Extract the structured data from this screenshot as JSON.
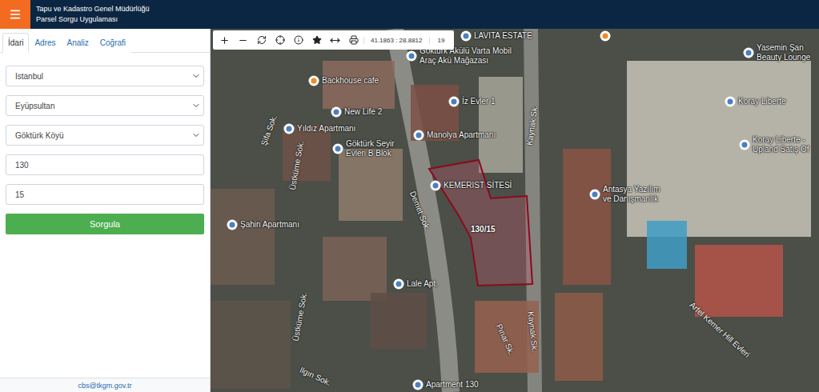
{
  "header": {
    "title_lines": [
      "Tapu ve Kadastro Genel Müdürlüğü",
      "Parsel Sorgu Uygulaması"
    ]
  },
  "tabs": [
    {
      "label": "İdari",
      "selected": true
    },
    {
      "label": "Adres",
      "selected": false
    },
    {
      "label": "Analiz",
      "selected": false
    },
    {
      "label": "Coğrafi",
      "selected": false
    }
  ],
  "form": {
    "fields": [
      {
        "kind": "select",
        "value": "İstanbul"
      },
      {
        "kind": "select",
        "value": "Eyüpsultan"
      },
      {
        "kind": "select",
        "value": "Göktürk Köyü"
      },
      {
        "kind": "input",
        "value": "130"
      },
      {
        "kind": "input",
        "value": "15"
      }
    ],
    "submit": "Sorgula"
  },
  "footer": "cbs@tkgm.gov.tr",
  "map": {
    "toolbar": {
      "coordinates": "41.1863 : 28.8812",
      "zoom": "19"
    },
    "parcel": {
      "label": "130/15"
    },
    "places": [
      {
        "kind": "pin",
        "lines": [
          "LAVITA ESTATE"
        ],
        "color": "#4a7fc1"
      },
      {
        "kind": "pin",
        "lines": [
          "Göktürk Akülü Varta Mobil",
          "Araç Akü Mağazası"
        ],
        "color": "#4a7fc1"
      },
      {
        "kind": "pin",
        "lines": [
          "Backhouse cafe"
        ],
        "color": "#f08a24"
      },
      {
        "kind": "pin",
        "lines": [],
        "color": "#f08a24"
      },
      {
        "kind": "pin",
        "lines": [
          "New Life 2"
        ],
        "color": "#4a7fc1"
      },
      {
        "kind": "pin",
        "lines": [
          "Yıldız Apartmanı"
        ],
        "color": "#4a7fc1"
      },
      {
        "kind": "pin",
        "lines": [
          "Göktürk Seyir",
          "Evleri B Blok"
        ],
        "color": "#4a7fc1"
      },
      {
        "kind": "pin",
        "lines": [
          "İz Evler 1"
        ],
        "color": "#4a7fc1"
      },
      {
        "kind": "pin",
        "lines": [
          "Manolya Apartmanı"
        ],
        "color": "#4a7fc1"
      },
      {
        "kind": "pin",
        "lines": [
          "KEMERIST SİTESİ"
        ],
        "color": "#4a7fc1"
      },
      {
        "kind": "pin",
        "lines": [
          "Şahin Apartmanı"
        ],
        "color": "#4a7fc1"
      },
      {
        "kind": "pin",
        "lines": [
          "Lale Apt."
        ],
        "color": "#4a7fc1"
      },
      {
        "kind": "pin",
        "lines": [
          "Antasya Yazılım",
          "ve Danışmanlık"
        ],
        "color": "#4a7fc1"
      },
      {
        "kind": "pin",
        "lines": [
          "Koray Liberte"
        ],
        "color": "#4a7fc1"
      },
      {
        "kind": "pin",
        "lines": [
          "Koray Liberte -",
          "Upland Satış Of"
        ],
        "color": "#4a7fc1"
      },
      {
        "kind": "pin",
        "lines": [
          "Yasemin Şan",
          "Beauty Lounge"
        ],
        "color": "#4a7fc1"
      },
      {
        "kind": "pin",
        "lines": [
          "Apartment 130"
        ],
        "color": "#4a7fc1"
      },
      {
        "kind": "street",
        "lines": [
          "Şifa Sok."
        ],
        "color": "#ffffff"
      },
      {
        "kind": "street",
        "lines": [
          "Üstküme Sok."
        ],
        "color": "#ffffff"
      },
      {
        "kind": "street",
        "lines": [
          "Üstküme Sok."
        ],
        "color": "#ffffff"
      },
      {
        "kind": "street",
        "lines": [
          "Demet Sok."
        ],
        "color": "#ffffff"
      },
      {
        "kind": "street",
        "lines": [
          "Kaynak Sk."
        ],
        "color": "#ffffff"
      },
      {
        "kind": "street",
        "lines": [
          "Kaynak Sk."
        ],
        "color": "#ffffff"
      },
      {
        "kind": "street",
        "lines": [
          "Pınar Sk."
        ],
        "color": "#ffffff"
      },
      {
        "kind": "street",
        "lines": [
          "Ilgın Sok."
        ],
        "color": "#ffffff"
      },
      {
        "kind": "street",
        "lines": [
          "Arfel Kemer Hill Evleri"
        ],
        "color": "#ffffff"
      }
    ]
  }
}
